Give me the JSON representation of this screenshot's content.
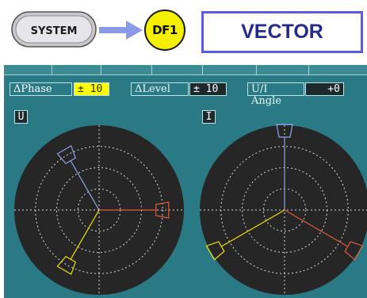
{
  "header": {
    "system_button_label": "SYSTEM",
    "df1_button_label": "DF1",
    "page_title": "VECTOR"
  },
  "settings": {
    "phase_label": "ΔPhase",
    "phase_value": "± 10",
    "level_label": "ΔLevel",
    "level_value": "± 10",
    "angle_label": "U/I Angle",
    "angle_value": "+0"
  },
  "channels": {
    "voltage_label": "U",
    "current_label": "I"
  },
  "colors": {
    "screen_bg": "#2a7a85",
    "phase1": "#e25a3a",
    "phase2": "#f2e000",
    "phase3": "#8ea4e6",
    "highlight": "#ffff00"
  },
  "vectors": {
    "voltage": [
      {
        "phase": "1",
        "angle_deg": 0,
        "magnitude": 0.78
      },
      {
        "phase": "2",
        "angle_deg": -120,
        "magnitude": 0.78
      },
      {
        "phase": "3",
        "angle_deg": 120,
        "magnitude": 0.78
      }
    ],
    "current": [
      {
        "phase": "1",
        "angle_deg": -30,
        "magnitude": 1.0
      },
      {
        "phase": "2",
        "angle_deg": -150,
        "magnitude": 1.0
      },
      {
        "phase": "3",
        "angle_deg": 90,
        "magnitude": 1.0
      }
    ]
  }
}
